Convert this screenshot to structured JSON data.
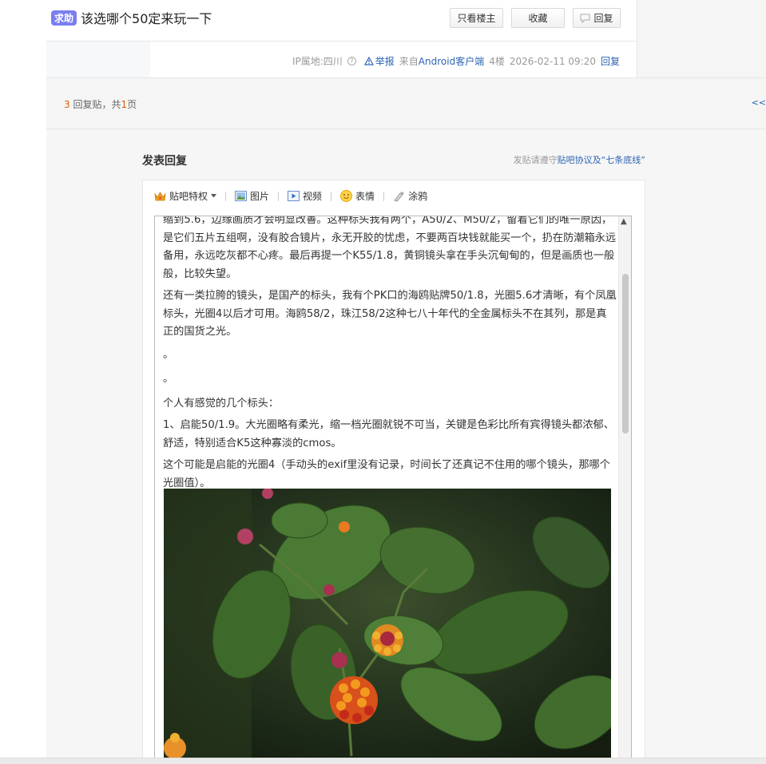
{
  "thread": {
    "tag": "求助",
    "title": "该选哪个50定来玩一下",
    "buttons": {
      "only_op": "只看楼主",
      "favorite": "收藏",
      "reply": "回复"
    }
  },
  "post_meta": {
    "ip": "IP属地:四川",
    "report": "举报",
    "from_prefix": "来自",
    "client": "Android客户端",
    "floor": "4楼",
    "datetime": "2026-02-11 09:20",
    "reply": "回复"
  },
  "pager": {
    "count": "3",
    "count_suffix": " 回复贴，共",
    "pages": "1",
    "pages_suffix": "页",
    "right_link": "<<"
  },
  "reply_section": {
    "title": "发表回复",
    "note_prefix": "发贴请遵守",
    "note_link": "贴吧协议及“七条底线”"
  },
  "toolbar": {
    "privilege": "贴吧特权",
    "image": "图片",
    "video": "视频",
    "emoji": "表情",
    "doodle": "涂鸦"
  },
  "editor": {
    "paragraphs": [
      "缩到5.6，边缘画质才会明显改善。这种标头我有两个，A50/2、M50/2，留着它们的唯一原因，是它们五片五组啊，没有胶合镜片，永无开胶的忧虑，不要两百块钱就能买一个，扔在防潮箱永远备用，永远吃灰都不心疼。最后再提一个K55/1.8，黄铜镜头拿在手头沉甸甸的，但是画质也一般般，比较失望。",
      "还有一类拉胯的镜头，是国产的标头，我有个PK口的海鸥贴牌50/1.8，光圈5.6才清晰，有个凤凰标头，光圈4以后才可用。海鸥58/2，珠江58/2这种七八十年代的全金属标头不在其列，那是真正的国货之光。",
      "。",
      "。",
      "个人有感觉的几个标头：",
      "1、启能50/1.9。大光圈略有柔光，缩一档光圈就锐不可当，关键是色彩比所有宾得镜头都浓郁、舒适，特别适合K5这种寡淡的cmos。",
      "这个可能是启能的光圈4（手动头的exif里没有记录，时间长了还真记不住用的哪个镜头，那哪个光圈值）。"
    ]
  },
  "colors": {
    "tag_bg": "#7a7ef0",
    "link_blue": "#2d64b3",
    "count_orange": "#e05b00"
  }
}
